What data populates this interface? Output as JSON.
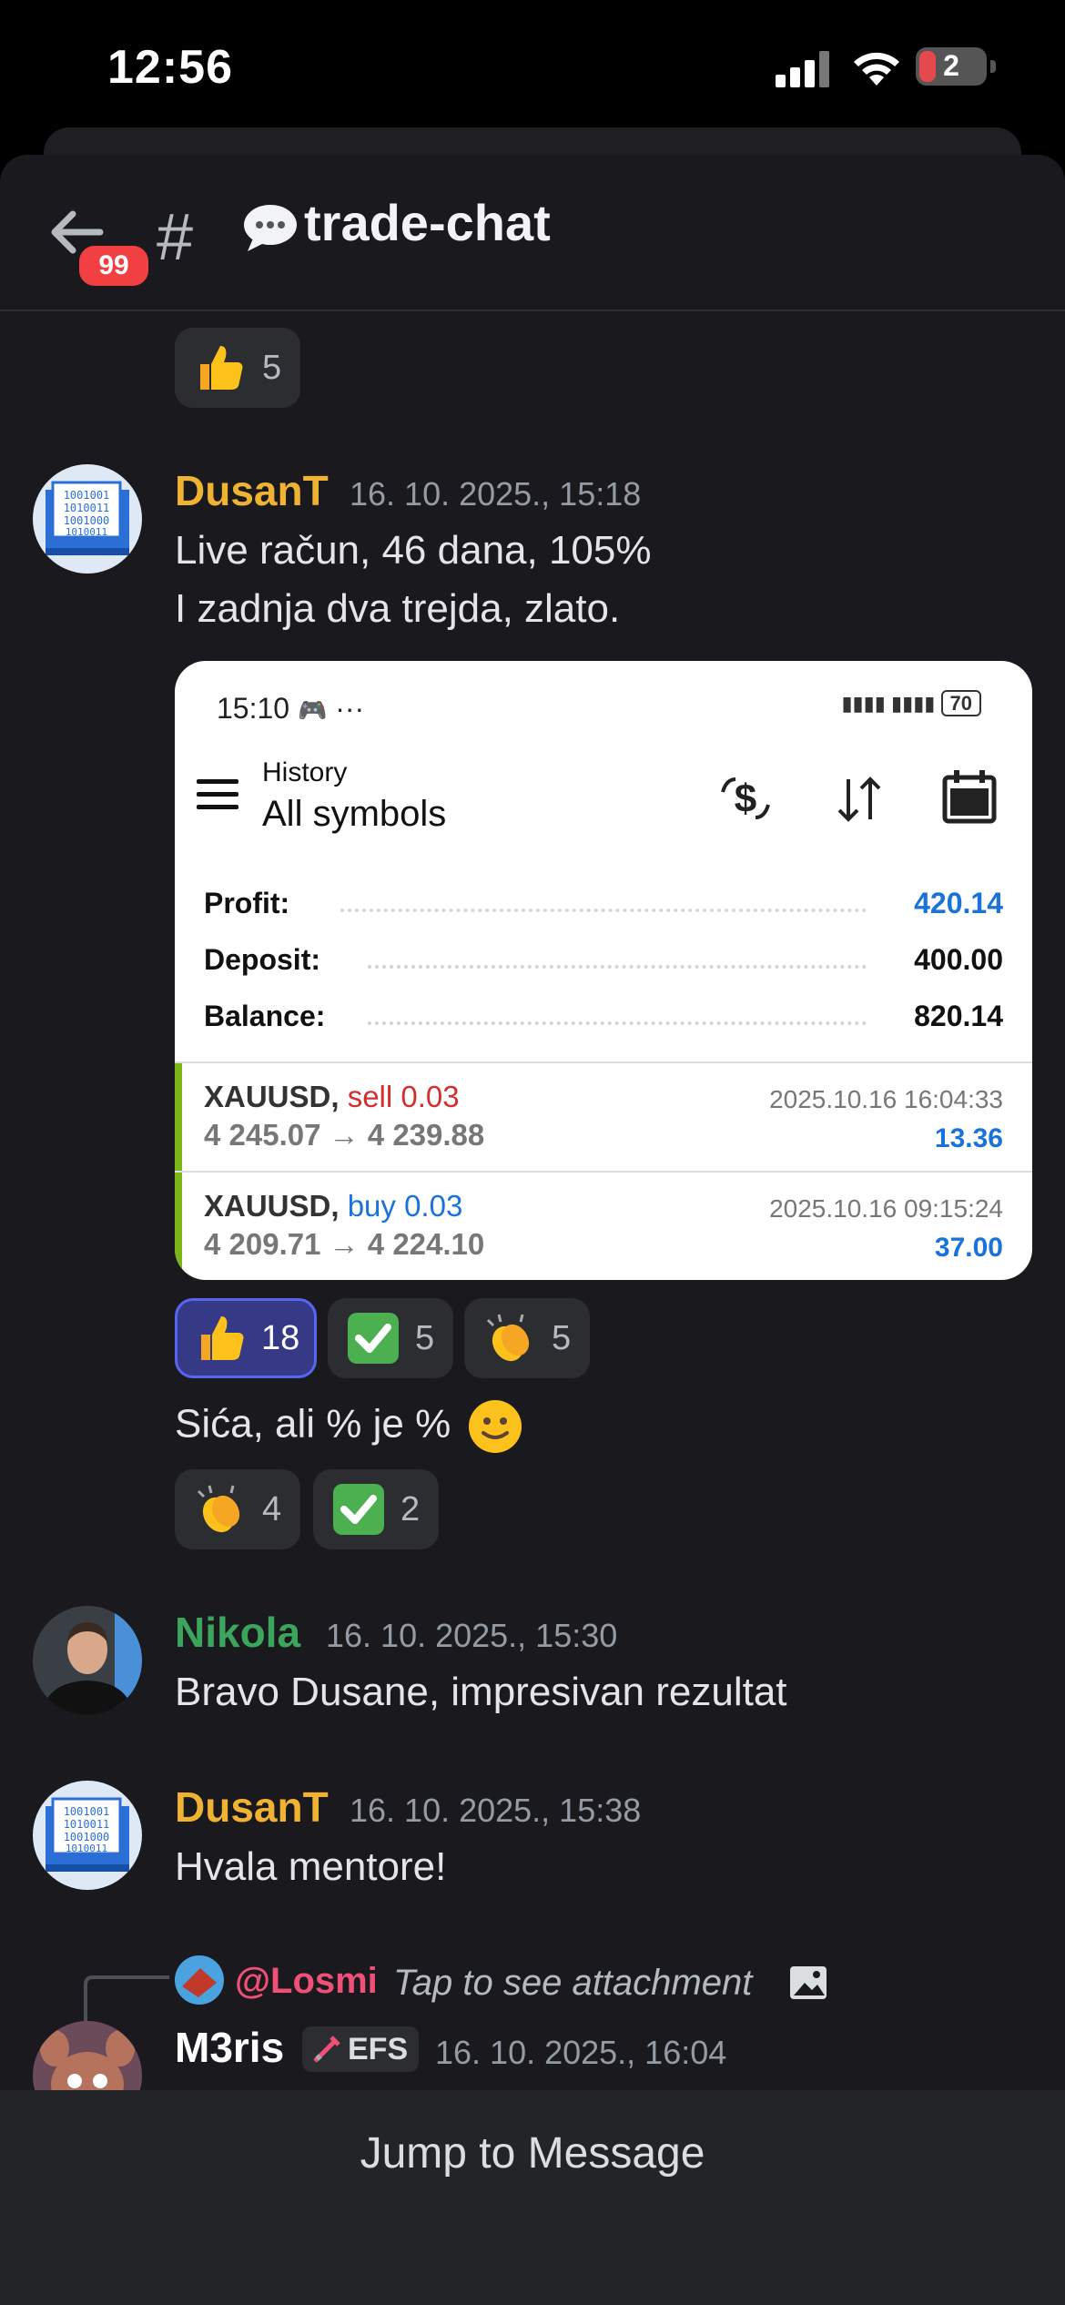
{
  "status_bar": {
    "time": "12:56",
    "battery": "2"
  },
  "header": {
    "back_badge": "99",
    "hash": "#",
    "channel_name": "trade-chat"
  },
  "messages": [
    {
      "author": "DusanT",
      "author_color": "#f0b232",
      "timestamp": "16. 10. 2025., 15:18",
      "lines": [
        "Live račun, 46 dana, 105%",
        "I zadnja dva trejda, zlato."
      ],
      "attachment": {
        "status_time": "15:10",
        "status_dots": "···",
        "battery": "70",
        "title_small": "History",
        "title_large": "All symbols",
        "summary": [
          {
            "label": "Profit:",
            "value": "420.14",
            "color": "#1a73d9"
          },
          {
            "label": "Deposit:",
            "value": "400.00",
            "color": "#111111"
          },
          {
            "label": "Balance:",
            "value": "820.14",
            "color": "#111111"
          }
        ],
        "deals": [
          {
            "symbol": "XAUUSD,",
            "side": "sell 0.03",
            "side_color": "#d32f2f",
            "prices": "4 245.07 → 4 239.88",
            "date": "2025.10.16 16:04:33",
            "pl": "13.36"
          },
          {
            "symbol": "XAUUSD,",
            "side": "buy 0.03",
            "side_color": "#1a73d9",
            "prices": "4 209.71 → 4 224.10",
            "date": "2025.10.16 09:15:24",
            "pl": "37.00"
          }
        ]
      },
      "reactions": [
        {
          "emoji": "thumbs-up",
          "count": "18",
          "active": true
        },
        {
          "emoji": "check-mark",
          "count": "5",
          "active": false
        },
        {
          "emoji": "clapping-hands",
          "count": "5",
          "active": false
        }
      ],
      "followup": "Sića, ali % je %",
      "followup_reactions": [
        {
          "emoji": "clapping-hands",
          "count": "4"
        },
        {
          "emoji": "check-mark",
          "count": "2"
        }
      ]
    },
    {
      "author": "Nikola",
      "author_color": "#3ba55c",
      "timestamp": "16. 10. 2025., 15:30",
      "text": "Bravo Dusane, impresivan rezultat"
    },
    {
      "author": "DusanT",
      "author_color": "#f0b232",
      "timestamp": "16. 10. 2025., 15:38",
      "text": "Hvala mentore!"
    },
    {
      "reply_to": "@Losmi",
      "reply_preview": "Tap to see attachment",
      "author": "M3ris",
      "author_color": "#ffffff",
      "tag": "EFS",
      "timestamp": "16. 10. 2025., 16:04"
    }
  ],
  "top_reaction": {
    "emoji": "thumbs-up",
    "count": "5"
  },
  "jump_button": "Jump to Message"
}
